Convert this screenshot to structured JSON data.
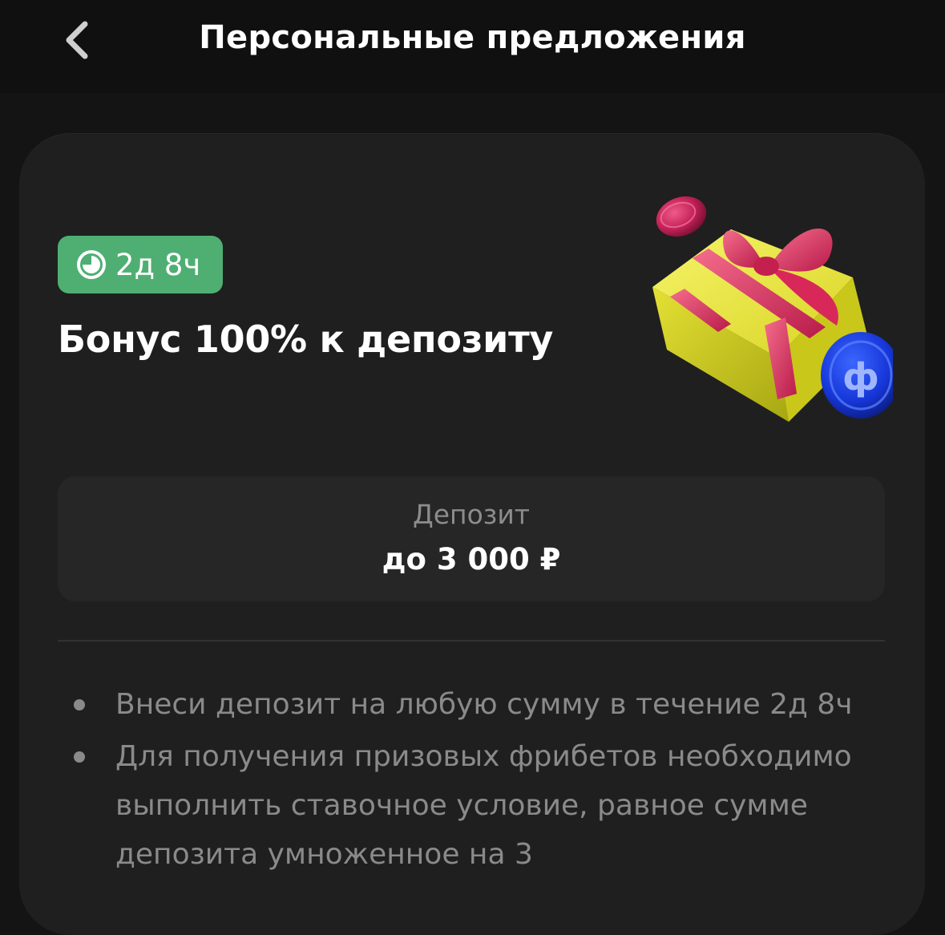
{
  "header": {
    "title": "Персональные предложения",
    "back_icon": "chevron-left-icon"
  },
  "offer": {
    "timer_icon": "clock-icon",
    "timer_text": "2д 8ч",
    "title": "Бонус 100% к депозиту",
    "illustration": "gift-box-with-coins",
    "deposit": {
      "label": "Депозит",
      "value": "до 3 000 ₽"
    },
    "conditions": [
      "Внеси депозит на любую сумму в течение 2д 8ч",
      "Для получения призовых фрибетов необходимо выполнить ставочное условие, равное сумме депозита умноженное на 3"
    ]
  },
  "colors": {
    "background": "#141414",
    "header": "#101010",
    "card": "#1f1f1f",
    "deposit_box": "#262626",
    "badge": "#4faf73",
    "muted_text": "#8a8a8a"
  }
}
